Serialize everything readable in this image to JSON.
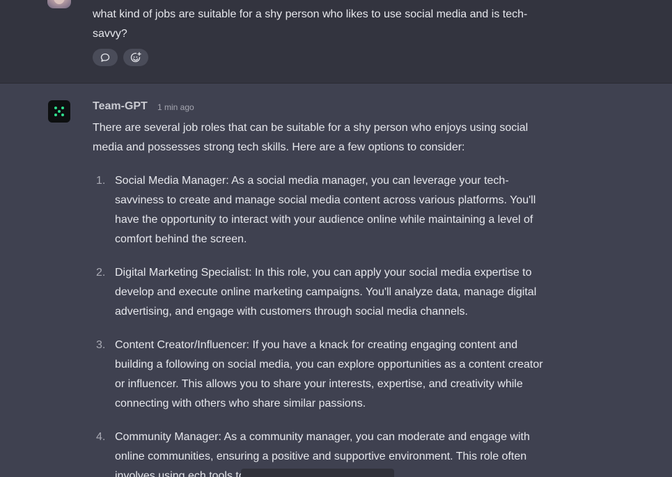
{
  "user_message": {
    "text": "what kind of jobs are suitable for a shy person who likes to use social media and is tech-savvy?",
    "actions": [
      {
        "name": "comment",
        "icon": "speech-bubble-icon"
      },
      {
        "name": "react",
        "icon": "add-emoji-icon"
      }
    ]
  },
  "assistant_message": {
    "author": "Team-GPT",
    "time": "1 min ago",
    "intro": "There are several job roles that can be suitable for a shy person who enjoys using social media and possesses strong tech skills. Here are a few options to consider:",
    "items": [
      {
        "number": "1.",
        "text": "Social Media Manager: As a social media manager, you can leverage your tech-savviness to create and manage social media content across various platforms. You'll have the opportunity to interact with your audience online while maintaining a level of comfort behind the screen."
      },
      {
        "number": "2.",
        "text": "Digital Marketing Specialist: In this role, you can apply your social media expertise to develop and execute online marketing campaigns. You'll analyze data, manage digital advertising, and engage with customers through social media channels."
      },
      {
        "number": "3.",
        "text": "Content Creator/Influencer: If you have a knack for creating engaging content and building a following on social media, you can explore opportunities as a content creator or influencer. This allows you to share your interests, expertise, and creativity while connecting with others who share similar passions."
      },
      {
        "number": "4.",
        "text": "Community Manager: As a community manager, you can moderate and engage with online communities, ensuring a positive and supportive environment. This role often involves using ech tools to connect with"
      }
    ]
  },
  "colors": {
    "user_bg": "#33343f",
    "assistant_bg": "#3f4150",
    "text": "#e6e7ec",
    "logo_accent": "#2fe08d"
  }
}
